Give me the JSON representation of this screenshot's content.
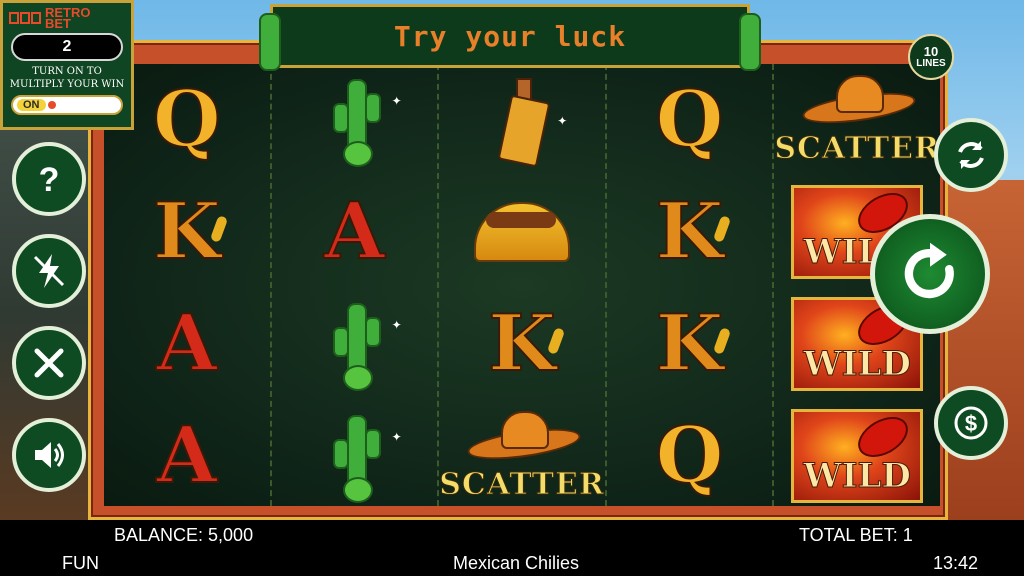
{
  "banner": {
    "title": "Try your luck"
  },
  "lines_badge": {
    "number": "10",
    "label": "LINES"
  },
  "retro_bet": {
    "logo_line1": "RETRO",
    "logo_line2": "BET",
    "value": "2",
    "caption": "TURN ON TO MULTIPLY YOUR WIN",
    "toggle_label": "ON"
  },
  "side_buttons": [
    {
      "icon": "help-icon"
    },
    {
      "icon": "turbo-off-icon"
    },
    {
      "icon": "settings-tools-icon"
    },
    {
      "icon": "sound-icon"
    }
  ],
  "right_buttons": [
    {
      "icon": "autoplay-icon"
    },
    {
      "icon": "spin-icon"
    },
    {
      "icon": "bet-coin-icon"
    }
  ],
  "reels": [
    [
      "Q",
      "K",
      "A",
      "A"
    ],
    [
      "cactus",
      "A",
      "cactus",
      "cactus"
    ],
    [
      "tequila",
      "taco",
      "K",
      "SCATTER"
    ],
    [
      "Q",
      "K",
      "K",
      "Q"
    ],
    [
      "SCATTER",
      "WILD",
      "WILD",
      "WILD"
    ]
  ],
  "symbol_text": {
    "scatter": "SCATTER",
    "wild": "WILD"
  },
  "status": {
    "balance": "BALANCE: 5,000",
    "total_bet": "TOTAL BET: 1",
    "mode": "FUN",
    "game_name": "Mexican Chilies",
    "time": "13:42"
  },
  "colors": {
    "felt": "#0f2418",
    "frame": "#c6502a",
    "gold": "#e7b43c",
    "button_green": "#0e4a22"
  }
}
